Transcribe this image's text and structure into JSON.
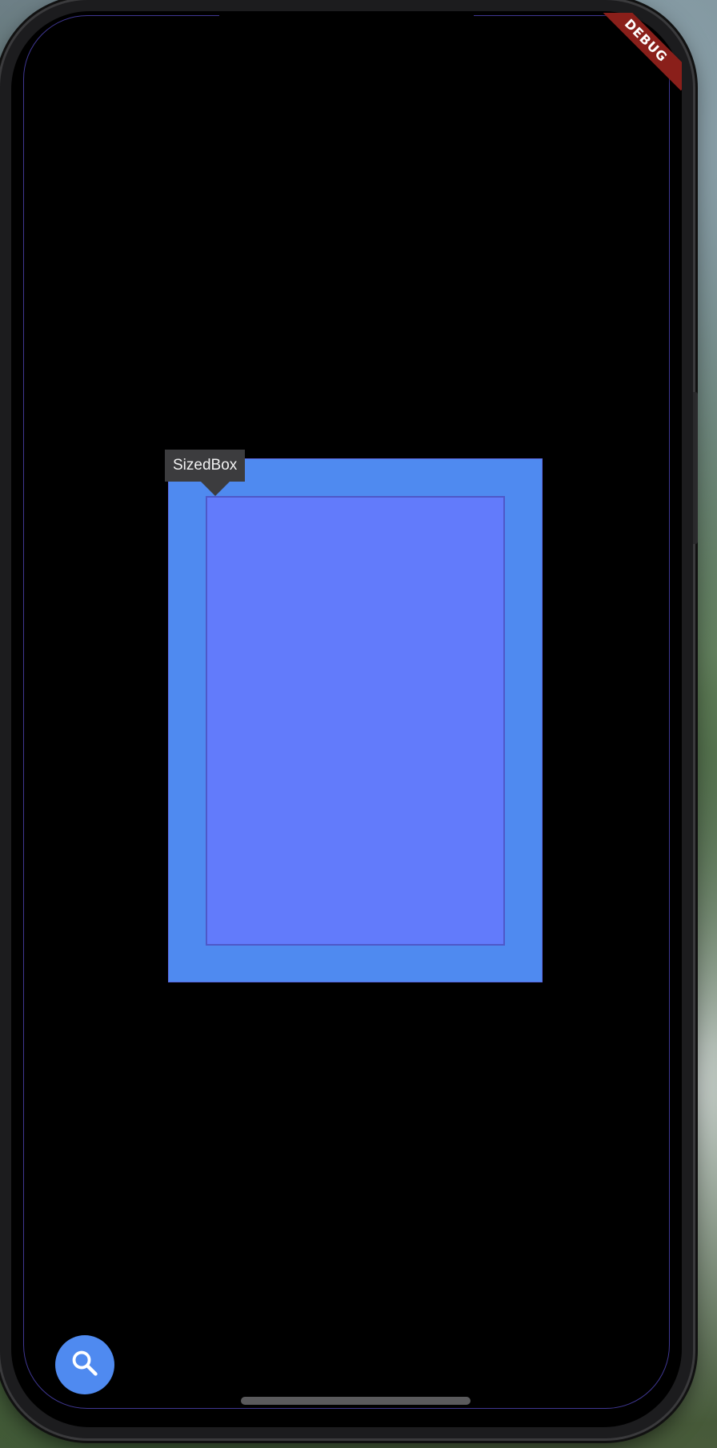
{
  "debug_banner": {
    "label": "DEBUG",
    "color": "#8a1f1a"
  },
  "inspector": {
    "tooltip_label": "SizedBox"
  },
  "layout_boxes": {
    "outer_color": "#4f8af0",
    "inner_color": "#627bfb"
  },
  "fab": {
    "icon": "search-icon",
    "color": "#4f8af0"
  }
}
